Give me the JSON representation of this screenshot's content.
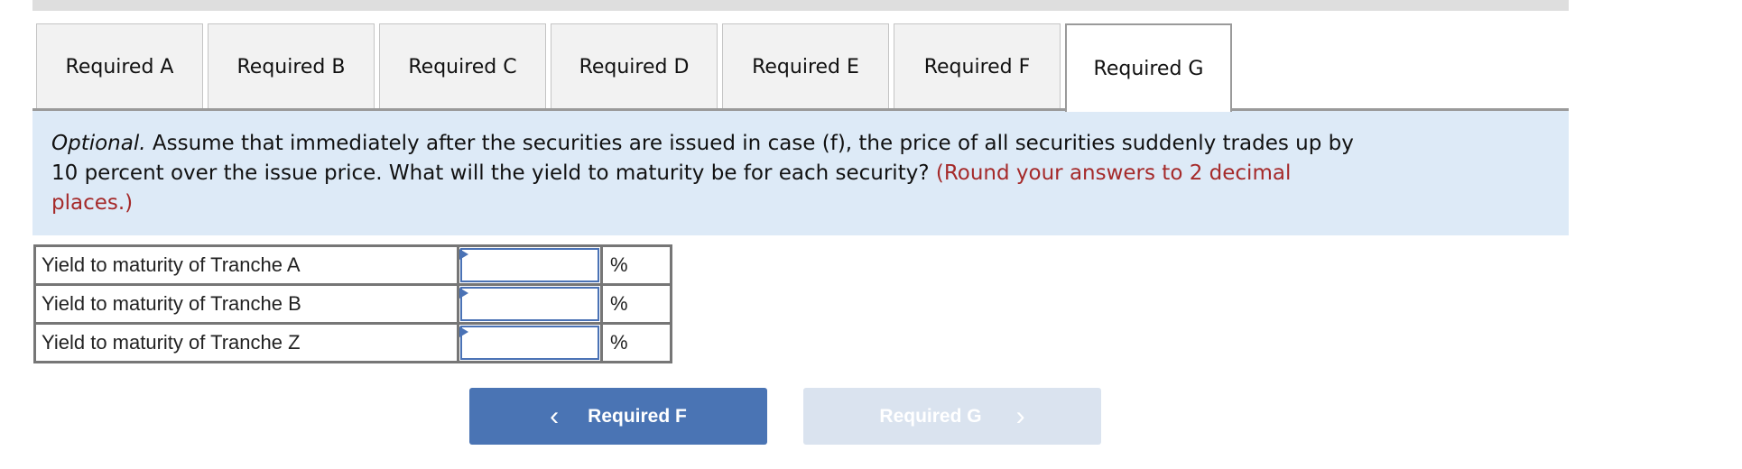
{
  "tabs": [
    {
      "label": "Required A",
      "active": false
    },
    {
      "label": "Required B",
      "active": false
    },
    {
      "label": "Required C",
      "active": false
    },
    {
      "label": "Required D",
      "active": false
    },
    {
      "label": "Required E",
      "active": false
    },
    {
      "label": "Required F",
      "active": false
    },
    {
      "label": "Required G",
      "active": true
    }
  ],
  "question": {
    "optional_label": "Optional.",
    "line1_rest": " Assume that immediately after the securities are issued in case (f), the price of all securities suddenly trades up by",
    "line2_black": "10 percent over the issue price. What will the yield to maturity be for each security?",
    "line2_red": " (Round your answers to 2 decimal",
    "line3_red": "places.)"
  },
  "answers": {
    "rows": [
      {
        "label": "Yield to maturity of Tranche A",
        "value": "",
        "unit": "%"
      },
      {
        "label": "Yield to maturity of Tranche B",
        "value": "",
        "unit": "%"
      },
      {
        "label": "Yield to maturity of Tranche Z",
        "value": "",
        "unit": "%"
      }
    ]
  },
  "navigation": {
    "prev_label": "Required F",
    "prev_icon": "chevron-left-icon",
    "next_label": "Required G",
    "next_icon": "chevron-right-icon",
    "next_disabled": true
  },
  "colors": {
    "accent": "#4a74b4",
    "question_bg": "#ddeaf7",
    "instruction_red": "#a52a2a",
    "disabled_button": "#dae3ef"
  }
}
